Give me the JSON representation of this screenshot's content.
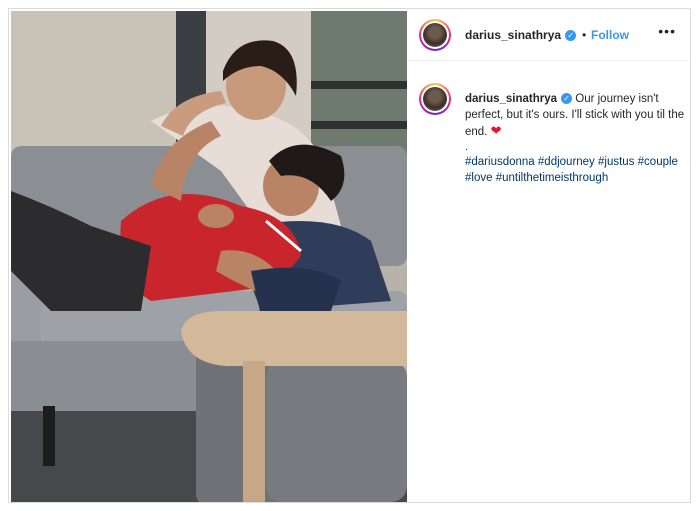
{
  "post": {
    "username": "darius_sinathrya",
    "separator": "•",
    "follow_label": "Follow",
    "more_label": "•••",
    "caption_text": "Our journey isn't perfect, but it's ours. I'll stick with you til the end.",
    "caption_emoji": "❤",
    "caption_dot": ".",
    "hashtags": [
      "#dariusdonna",
      "#ddjourney",
      "#justus",
      "#couple",
      "#love",
      "#untilthetimeisthrough"
    ]
  },
  "colors": {
    "link_blue": "#3897f0",
    "hashtag": "#00376b",
    "heart": "#e0182d"
  },
  "icons": {
    "verified": "verified-badge-icon",
    "more": "more-options-icon",
    "heart": "red-heart-icon"
  }
}
